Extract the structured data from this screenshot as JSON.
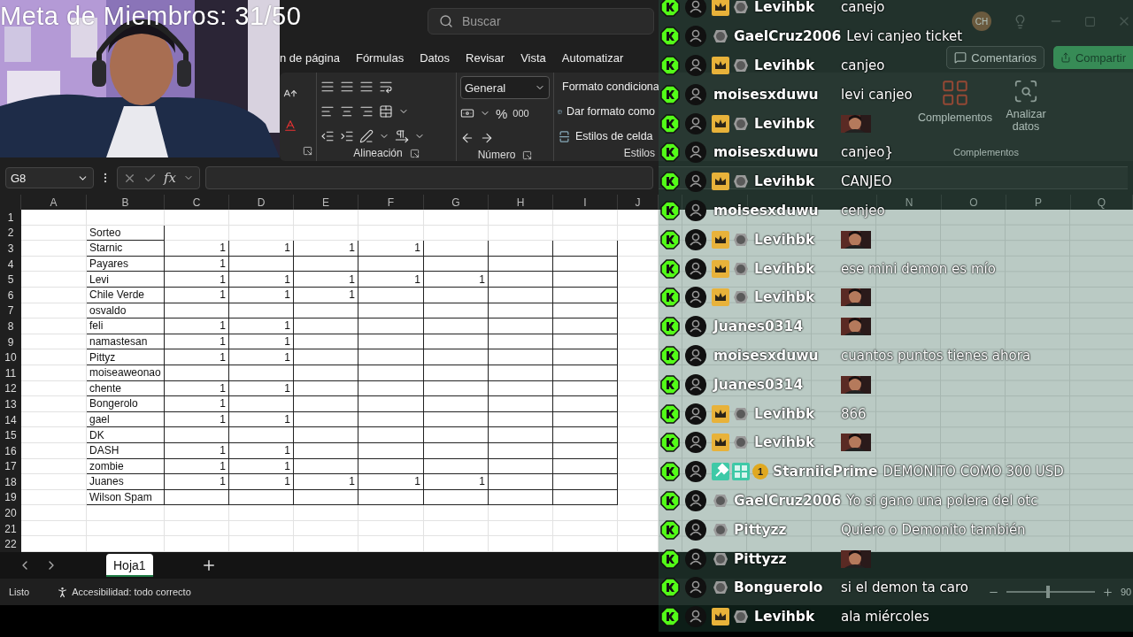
{
  "overlay_title": "Meta de Miembros: 31/50",
  "search": {
    "placeholder": "Buscar"
  },
  "ribbon_tabs": [
    "n de página",
    "Fórmulas",
    "Datos",
    "Revisar",
    "Vista",
    "Automatizar"
  ],
  "ribbon": {
    "alignment_label": "Alineación",
    "number_format": "General",
    "percent": "%",
    "thousands": "000",
    "number_label": "Número",
    "styles": [
      "Formato condiciona",
      "Dar formato como",
      "Estilos de celda"
    ],
    "styles_label": "Estilos"
  },
  "right_ribbon": {
    "account": "CH",
    "comments": "Comentarios",
    "share": "Compartir",
    "addins": "Complementos",
    "analyze": "Analizar datos",
    "group_label": "Complementos"
  },
  "formula_bar": {
    "name_box": "G8",
    "fx": "fx"
  },
  "columns": [
    "A",
    "B",
    "C",
    "D",
    "E",
    "F",
    "G",
    "H",
    "I",
    "J"
  ],
  "right_columns": [
    "N",
    "O",
    "P",
    "Q"
  ],
  "rows": [
    {
      "number": "1",
      "cells": []
    },
    {
      "number": "2",
      "cells": [
        "Sorteo"
      ]
    },
    {
      "number": "3",
      "cells": [
        "Starnic",
        "1",
        "1",
        "1",
        "1"
      ]
    },
    {
      "number": "4",
      "cells": [
        "Payares",
        "1"
      ]
    },
    {
      "number": "5",
      "cells": [
        "Levi",
        "1",
        "1",
        "1",
        "1",
        "1"
      ]
    },
    {
      "number": "6",
      "cells": [
        "Chile Verde",
        "1",
        "1",
        "1"
      ]
    },
    {
      "number": "7",
      "cells": [
        "osvaldo"
      ]
    },
    {
      "number": "8",
      "cells": [
        "feli",
        "1",
        "1"
      ]
    },
    {
      "number": "9",
      "cells": [
        "namastesan",
        "1",
        "1"
      ]
    },
    {
      "number": "10",
      "cells": [
        "Pittyz",
        "1",
        "1"
      ]
    },
    {
      "number": "11",
      "cells": [
        "moiseaweonao"
      ]
    },
    {
      "number": "12",
      "cells": [
        "chente",
        "1",
        "1"
      ]
    },
    {
      "number": "13",
      "cells": [
        "Bongerolo",
        "1"
      ]
    },
    {
      "number": "14",
      "cells": [
        "gael",
        "1",
        "1"
      ]
    },
    {
      "number": "15",
      "cells": [
        "DK"
      ]
    },
    {
      "number": "16",
      "cells": [
        "DASH",
        "1",
        "1"
      ]
    },
    {
      "number": "17",
      "cells": [
        "zombie",
        "1",
        "1"
      ]
    },
    {
      "number": "18",
      "cells": [
        "Juanes",
        "1",
        "1",
        "1",
        "1",
        "1"
      ]
    },
    {
      "number": "19",
      "cells": [
        "Wilson Spam"
      ]
    },
    {
      "number": "20",
      "cells": []
    },
    {
      "number": "21",
      "cells": []
    },
    {
      "number": "22",
      "cells": []
    }
  ],
  "sheet_tabs": [
    {
      "label": "Hoja1",
      "selected": true
    }
  ],
  "status_bar": {
    "ready": "Listo",
    "accessibility": "Accesibilidad: todo correcto",
    "zoom": {
      "level": 0.45,
      "reading": "90"
    }
  },
  "chat": [
    {
      "user": "Levihbk",
      "badges": [
        {
          "kind": "crown"
        },
        {
          "kind": "emblem"
        }
      ],
      "kind": "text",
      "message": "canejo"
    },
    {
      "user": "GaelCruz2006",
      "badges": [
        {
          "kind": "emblem"
        }
      ],
      "kind": "text",
      "message": "Levi canjeo ticket"
    },
    {
      "user": "Levihbk",
      "badges": [
        {
          "kind": "crown"
        },
        {
          "kind": "emblem"
        }
      ],
      "kind": "text",
      "message": "canjeo"
    },
    {
      "user": "moisesxduwu",
      "kind": "text",
      "message": "levi canjeo"
    },
    {
      "user": "Levihbk",
      "badges": [
        {
          "kind": "crown"
        },
        {
          "kind": "emblem"
        }
      ],
      "kind": "emote"
    },
    {
      "user": "moisesxduwu",
      "kind": "text",
      "message": "canjeo}"
    },
    {
      "user": "Levihbk",
      "badges": [
        {
          "kind": "crown"
        },
        {
          "kind": "emblem"
        }
      ],
      "kind": "text",
      "message": "CANJEO"
    },
    {
      "user": "moisesxduwu",
      "kind": "text",
      "message": "cenjeo"
    },
    {
      "user": "Levihbk",
      "badges": [
        {
          "kind": "crown"
        },
        {
          "kind": "emblem"
        }
      ],
      "kind": "emote"
    },
    {
      "user": "Levihbk",
      "badges": [
        {
          "kind": "crown"
        },
        {
          "kind": "emblem"
        }
      ],
      "kind": "text",
      "message": "ese mini demon es mío"
    },
    {
      "user": "Levihbk",
      "badges": [
        {
          "kind": "crown"
        },
        {
          "kind": "emblem"
        }
      ],
      "kind": "emote"
    },
    {
      "user": "Juanes0314",
      "kind": "emote"
    },
    {
      "user": "moisesxduwu",
      "kind": "text",
      "message": "cuantos puntos tienes ahora"
    },
    {
      "user": "Juanes0314",
      "kind": "emote"
    },
    {
      "user": "Levihbk",
      "badges": [
        {
          "kind": "crown"
        },
        {
          "kind": "emblem"
        }
      ],
      "kind": "text",
      "message": "866"
    },
    {
      "user": "Levihbk",
      "badges": [
        {
          "kind": "crown"
        },
        {
          "kind": "emblem"
        }
      ],
      "kind": "emote"
    },
    {
      "user": "StarniicPrime",
      "badges": [
        {
          "kind": "hammer"
        },
        {
          "kind": "grid"
        },
        {
          "kind": "count",
          "text": "1"
        }
      ],
      "kind": "text",
      "message": "DEMONITO COMO 300 USD"
    },
    {
      "user": "GaelCruz2006",
      "badges": [
        {
          "kind": "emblem"
        }
      ],
      "kind": "text",
      "message": "Yo si gano una polera del otc"
    },
    {
      "user": "Pittyzz",
      "badges": [
        {
          "kind": "emblem"
        }
      ],
      "kind": "text",
      "message": "Quiero o Demonito también"
    },
    {
      "user": "Pittyzz",
      "badges": [
        {
          "kind": "emblem"
        }
      ],
      "kind": "emote"
    },
    {
      "user": "Bonguerolo",
      "badges": [
        {
          "kind": "emblem"
        }
      ],
      "kind": "text",
      "message": "si el demon ta caro"
    },
    {
      "user": "Levihbk",
      "badges": [
        {
          "kind": "crown"
        },
        {
          "kind": "emblem"
        }
      ],
      "kind": "text",
      "message": "ala miércoles"
    }
  ]
}
